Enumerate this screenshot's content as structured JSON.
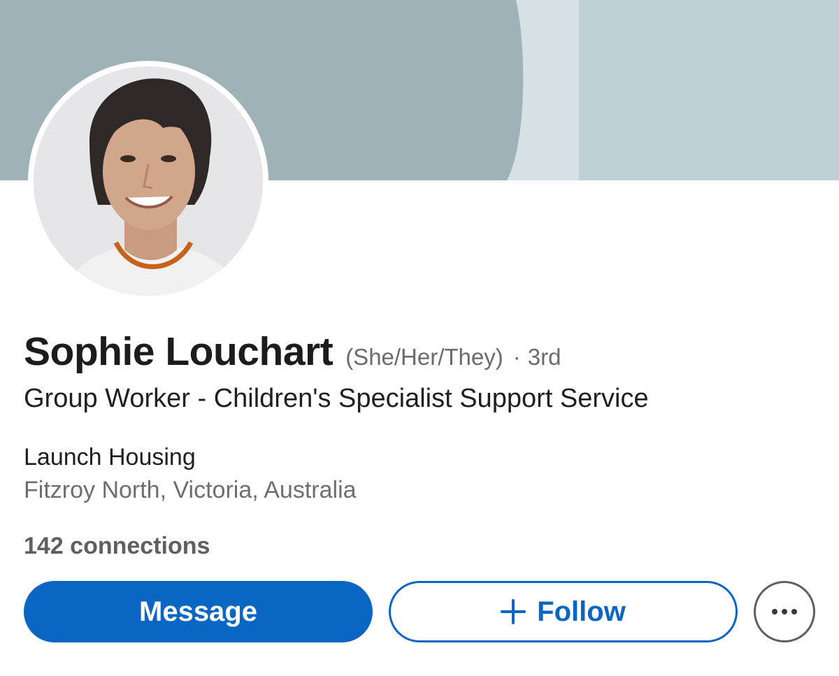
{
  "profile": {
    "name": "Sophie Louchart",
    "pronouns": "(She/Her/They)",
    "separator": "·",
    "degree": "3rd",
    "headline": "Group Worker - Children's Specialist Support Service",
    "company": "Launch Housing",
    "location": "Fitzroy North, Victoria, Australia",
    "connections": "142 connections"
  },
  "actions": {
    "message_label": "Message",
    "follow_label": "Follow",
    "more_icon": "more-horizontal-icon",
    "follow_icon": "plus-icon"
  },
  "colors": {
    "primary": "#0a66c2",
    "banner_dark": "#9fb2b6",
    "banner_light": "#bfd1d5",
    "banner_pale": "#d5e1e4",
    "text_secondary": "#6b6b6b"
  }
}
